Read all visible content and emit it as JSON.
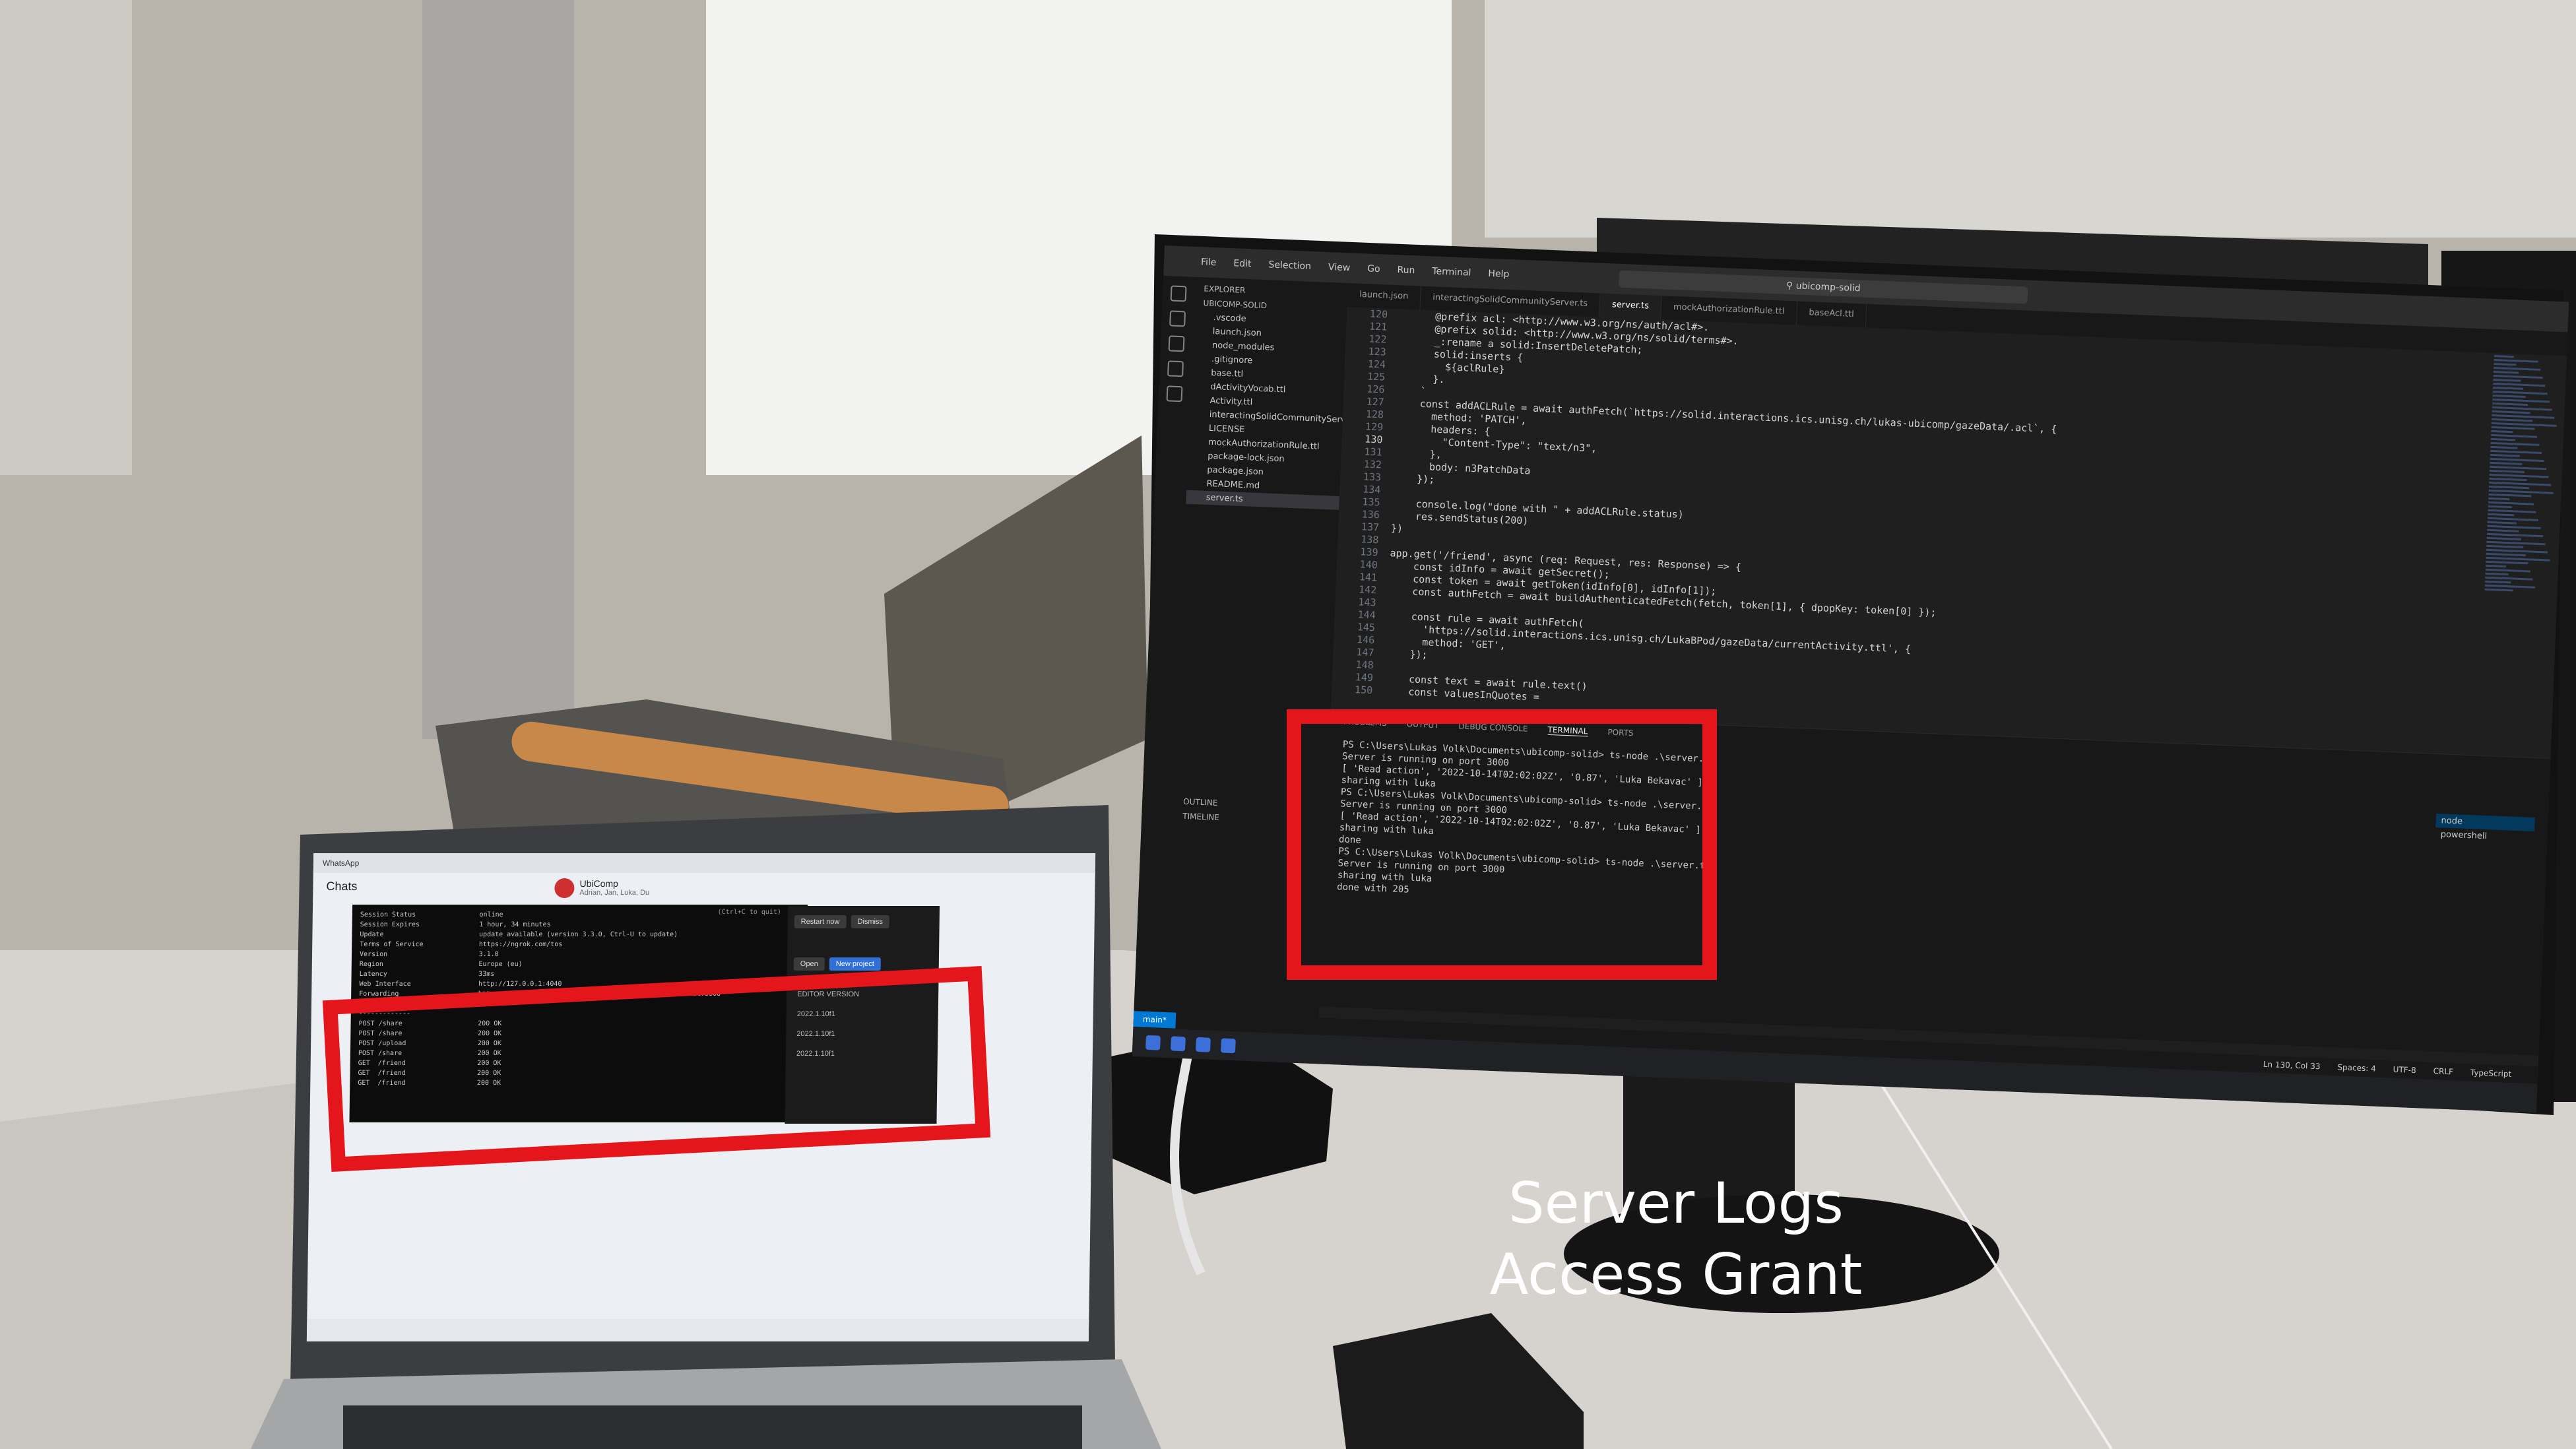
{
  "caption": {
    "line1": "Server Logs",
    "line2": "Access Grant"
  },
  "vscode": {
    "menu": [
      "File",
      "Edit",
      "Selection",
      "View",
      "Go",
      "Run",
      "Terminal",
      "Help"
    ],
    "search": "ubicomp-solid",
    "sidebar": {
      "title": "EXPLORER",
      "root": "UBICOMP-SOLID",
      "items": [
        ".vscode",
        "launch.json",
        "node_modules",
        ".gitignore",
        "base.ttl",
        "dActivityVocab.ttl",
        "Activity.ttl",
        "interactingSolidCommunityServ...",
        "LICENSE",
        "mockAuthorizationRule.ttl",
        "package-lock.json",
        "package.json",
        "README.md",
        "server.ts"
      ],
      "outline": "OUTLINE",
      "timeline": "TIMELINE"
    },
    "tabs": [
      "launch.json",
      "interactingSolidCommunityServer.ts",
      "server.ts",
      "mockAuthorizationRule.ttl",
      "baseAcl.ttl"
    ],
    "editor_lines": [
      {
        "n": "120",
        "code": "      @prefix acl: <http://www.w3.org/ns/auth/acl#>."
      },
      {
        "n": "121",
        "code": "      @prefix solid: <http://www.w3.org/ns/solid/terms#>."
      },
      {
        "n": "122",
        "code": "      _:rename a solid:InsertDeletePatch;"
      },
      {
        "n": "123",
        "code": "      solid:inserts {"
      },
      {
        "n": "124",
        "code": "        ${aclRule}"
      },
      {
        "n": "125",
        "code": "      }."
      },
      {
        "n": "126",
        "code": "    `"
      },
      {
        "n": "127",
        "code": "    const addACLRule = await authFetch(`https://solid.interactions.ics.unisg.ch/lukas-ubicomp/gazeData/.acl`, {"
      },
      {
        "n": "128",
        "code": "      method: 'PATCH',"
      },
      {
        "n": "129",
        "code": "      headers: {"
      },
      {
        "n": "130",
        "code": "        \"Content-Type\": \"text/n3\","
      },
      {
        "n": "131",
        "code": "      },"
      },
      {
        "n": "132",
        "code": "      body: n3PatchData"
      },
      {
        "n": "133",
        "code": "    });"
      },
      {
        "n": "134",
        "code": ""
      },
      {
        "n": "135",
        "code": "    console.log(\"done with \" + addACLRule.status)"
      },
      {
        "n": "136",
        "code": "    res.sendStatus(200)"
      },
      {
        "n": "137",
        "code": "})"
      },
      {
        "n": "138",
        "code": ""
      },
      {
        "n": "139",
        "code": "app.get('/friend', async (req: Request, res: Response) => {"
      },
      {
        "n": "140",
        "code": "    const idInfo = await getSecret();"
      },
      {
        "n": "141",
        "code": "    const token = await getToken(idInfo[0], idInfo[1]);"
      },
      {
        "n": "142",
        "code": "    const authFetch = await buildAuthenticatedFetch(fetch, token[1], { dpopKey: token[0] });"
      },
      {
        "n": "143",
        "code": ""
      },
      {
        "n": "144",
        "code": "    const rule = await authFetch("
      },
      {
        "n": "145",
        "code": "      'https://solid.interactions.ics.unisg.ch/LukaBPod/gazeData/currentActivity.ttl', {"
      },
      {
        "n": "146",
        "code": "      method: 'GET',"
      },
      {
        "n": "147",
        "code": "    });"
      },
      {
        "n": "148",
        "code": ""
      },
      {
        "n": "149",
        "code": "    const text = await rule.text()"
      },
      {
        "n": "150",
        "code": "    const valuesInQuotes ="
      }
    ],
    "panel_tabs": [
      "PROBLEMS",
      "OUTPUT",
      "DEBUG CONSOLE",
      "TERMINAL",
      "PORTS"
    ],
    "terminal_lines": [
      "PS C:\\Users\\Lukas Volk\\Documents\\ubicomp-solid> ts-node .\\server.ts",
      "Server is running on port 3000",
      "[ 'Read action', '2022-10-14T02:02:02Z', '0.87', 'Luka Bekavac' ]",
      "sharing with luka",
      "",
      "PS C:\\Users\\Lukas Volk\\Documents\\ubicomp-solid> ts-node .\\server.ts",
      "Server is running on port 3000",
      "[ 'Read action', '2022-10-14T02:02:02Z', '0.87', 'Luka Bekavac' ]",
      "sharing with luka",
      "done",
      "",
      "PS C:\\Users\\Lukas Volk\\Documents\\ubicomp-solid> ts-node .\\server.ts",
      "Server is running on port 3000",
      "sharing with luka",
      "done with 205"
    ],
    "terminal_list": [
      "node",
      "powershell"
    ],
    "status": {
      "branch": "main*",
      "position": "Ln 130, Col 33",
      "spaces": "Spaces: 4",
      "encoding": "UTF-8",
      "eol": "CRLF",
      "language": "TypeScript"
    }
  },
  "laptop": {
    "app_title": "WhatsApp",
    "chats_header": "Chats",
    "chat_title": "UbiComp",
    "chat_subtitle": "Adrian, Jan, Luka, Du",
    "ngrok": {
      "quit_hint": "(Ctrl+C to quit)",
      "lines": [
        "Session Status                online",
        "Session Expires               1 hour, 34 minutes",
        "Update                        update available (version 3.3.0, Ctrl-U to update)",
        "Terms of Service              https://ngrok.com/tos",
        "Version                       3.1.0",
        "Region                        Europe (eu)",
        "Latency                       33ms",
        "Web Interface                 http://127.0.0.1:4040",
        "Forwarding                    https://9012-138-81-145-231.ngrok.io -> http://localhost:3000",
        "",
        "HTTP Requests",
        "-------------",
        "",
        "POST /share                   200 OK",
        "POST /share                   200 OK",
        "POST /upload                  200 OK",
        "POST /share                   200 OK",
        "GET  /friend                  200 OK",
        "GET  /friend                  200 OK",
        "GET  /friend                  200 OK"
      ]
    },
    "unity": {
      "restart": "Restart now",
      "dismiss": "Dismiss",
      "open": "Open",
      "new_project": "New project",
      "versions_header": "EDITOR VERSION",
      "versions": [
        "2022.1.10f1",
        "2022.1.10f1",
        "2022.1.10f1"
      ]
    }
  }
}
